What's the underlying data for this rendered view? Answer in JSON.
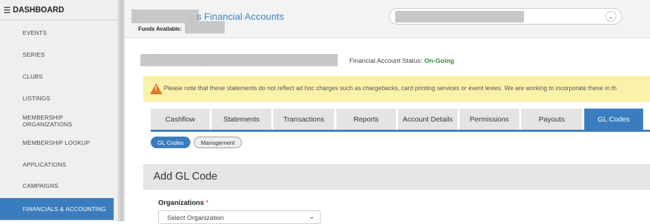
{
  "sidebar": {
    "header": "DASHBOARD",
    "items": [
      {
        "label": "EVENTS"
      },
      {
        "label": "SERIES"
      },
      {
        "label": "CLUBS"
      },
      {
        "label": "LISTINGS"
      },
      {
        "label": "MEMBERSHIP ORGANIZATIONS"
      },
      {
        "label": "MEMBERSHIP LOOKUP"
      },
      {
        "label": "APPLICATIONS"
      },
      {
        "label": "CAMPAIGNS"
      },
      {
        "label": "FINANCIALS & ACCOUNTING"
      }
    ]
  },
  "header": {
    "title": "s Financial Accounts",
    "funds_label": "Funds Available:"
  },
  "status": {
    "label": "Financial Account Status:",
    "value": "On-Going"
  },
  "notice": {
    "text": "Please note that these statements do not reflect ad hoc charges such as chargebacks, card printing services or event levies. We are working to incorporate these in th"
  },
  "tabs": [
    {
      "label": "Cashflow"
    },
    {
      "label": "Statements"
    },
    {
      "label": "Transactions"
    },
    {
      "label": "Reports"
    },
    {
      "label": "Account Details"
    },
    {
      "label": "Permissions"
    },
    {
      "label": "Payouts"
    },
    {
      "label": "GL Codes"
    }
  ],
  "subtabs": {
    "gl_codes": "GL Codes",
    "management": "Management"
  },
  "panel": {
    "title": "Add GL Code",
    "org_label": "Organizations",
    "org_required": "*",
    "org_placeholder": "Select Organization"
  },
  "colors": {
    "accent": "#3a7dbf",
    "status_ok": "#2f8f2f",
    "notice_bg": "#faf2a8",
    "warning": "#e0792a"
  }
}
